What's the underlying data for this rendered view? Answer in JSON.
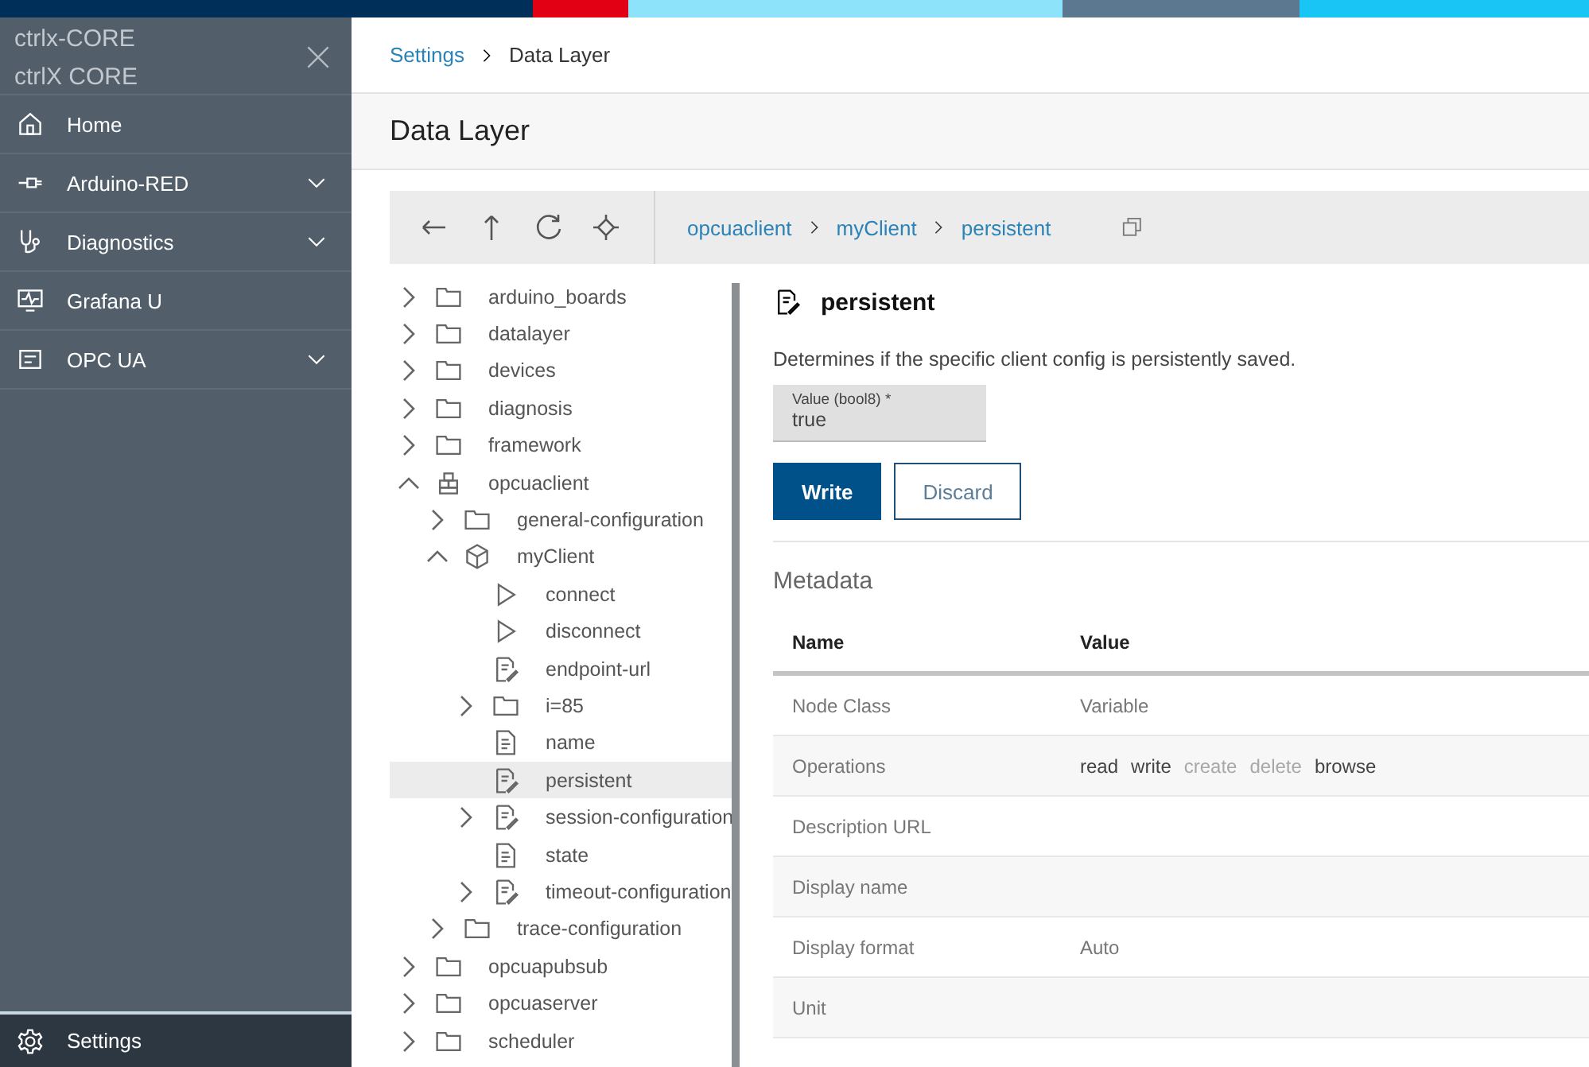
{
  "sidebar": {
    "header_lines": [
      "ctrlx-CORE",
      "ctrlX CORE"
    ],
    "items": [
      {
        "label": "Home",
        "expandable": false
      },
      {
        "label": "Arduino-RED",
        "expandable": true
      },
      {
        "label": "Diagnostics",
        "expandable": true
      },
      {
        "label": "Grafana U",
        "expandable": false
      },
      {
        "label": "OPC UA",
        "expandable": true
      }
    ],
    "footer": {
      "label": "Settings"
    }
  },
  "breadcrumb": [
    "Settings",
    "Data Layer"
  ],
  "page_title": "Data Layer",
  "path": [
    "opcuaclient",
    "myClient",
    "persistent"
  ],
  "tree": [
    {
      "label": "arduino_boards",
      "kind": "folder",
      "expandable": true,
      "expanded": false,
      "selected": false
    },
    {
      "label": "datalayer",
      "kind": "folder",
      "expandable": true,
      "expanded": false,
      "selected": false
    },
    {
      "label": "devices",
      "kind": "folder",
      "expandable": true,
      "expanded": false,
      "selected": false
    },
    {
      "label": "diagnosis",
      "kind": "folder",
      "expandable": true,
      "expanded": false,
      "selected": false
    },
    {
      "label": "framework",
      "kind": "folder",
      "expandable": true,
      "expanded": false,
      "selected": false
    },
    {
      "label": "opcuaclient",
      "kind": "blocks",
      "expandable": true,
      "expanded": true,
      "selected": false,
      "children": [
        {
          "label": "general-configuration",
          "kind": "folder",
          "expandable": true,
          "expanded": false,
          "selected": false
        },
        {
          "label": "myClient",
          "kind": "cube",
          "expandable": true,
          "expanded": true,
          "selected": false,
          "children": [
            {
              "label": "connect",
              "kind": "method",
              "expandable": false,
              "expanded": false,
              "selected": false
            },
            {
              "label": "disconnect",
              "kind": "method",
              "expandable": false,
              "expanded": false,
              "selected": false
            },
            {
              "label": "endpoint-url",
              "kind": "editable",
              "expandable": false,
              "expanded": false,
              "selected": false
            },
            {
              "label": "i=85",
              "kind": "folder",
              "expandable": true,
              "expanded": false,
              "selected": false
            },
            {
              "label": "name",
              "kind": "readonly",
              "expandable": false,
              "expanded": false,
              "selected": false
            },
            {
              "label": "persistent",
              "kind": "editable",
              "expandable": false,
              "expanded": false,
              "selected": true
            },
            {
              "label": "session-configuration",
              "kind": "editable",
              "expandable": true,
              "expanded": false,
              "selected": false
            },
            {
              "label": "state",
              "kind": "readonly",
              "expandable": false,
              "expanded": false,
              "selected": false
            },
            {
              "label": "timeout-configuration",
              "kind": "editable",
              "expandable": true,
              "expanded": false,
              "selected": false
            }
          ]
        },
        {
          "label": "trace-configuration",
          "kind": "folder",
          "expandable": true,
          "expanded": false,
          "selected": false
        }
      ]
    },
    {
      "label": "opcuapubsub",
      "kind": "folder",
      "expandable": true,
      "expanded": false,
      "selected": false
    },
    {
      "label": "opcuaserver",
      "kind": "folder",
      "expandable": true,
      "expanded": false,
      "selected": false
    },
    {
      "label": "scheduler",
      "kind": "folder",
      "expandable": true,
      "expanded": false,
      "selected": false
    }
  ],
  "detail": {
    "title": "persistent",
    "description": "Determines if the specific client config is persistently saved.",
    "field": {
      "label": "Value (bool8) *",
      "value": "true"
    },
    "buttons": [
      {
        "label": "Write",
        "kind": "primary"
      },
      {
        "label": "Discard",
        "kind": "secondary"
      }
    ],
    "metadata_title": "Metadata",
    "columns": [
      "Name",
      "Value"
    ],
    "rows": [
      {
        "name": "Node Class",
        "value": "Variable"
      },
      {
        "name": "Operations",
        "operations": [
          {
            "label": "read",
            "disabled": false
          },
          {
            "label": "write",
            "disabled": false
          },
          {
            "label": "create",
            "disabled": true
          },
          {
            "label": "delete",
            "disabled": true
          },
          {
            "label": "browse",
            "disabled": false
          }
        ]
      },
      {
        "name": "Description URL"
      },
      {
        "name": "Display name"
      },
      {
        "name": "Display format",
        "value": "Auto"
      },
      {
        "name": "Unit"
      }
    ]
  }
}
